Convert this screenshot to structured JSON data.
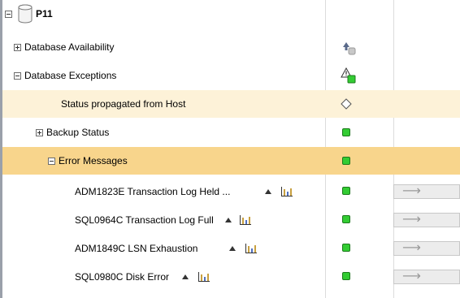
{
  "tree": {
    "root": {
      "label": "P11"
    },
    "rows": [
      {
        "label": "Database Availability",
        "expander": "plus",
        "status_icon": "availability-arrow-icon"
      },
      {
        "label": "Database  Exceptions",
        "expander": "minus",
        "status_icon": "warning-triangle-icon"
      },
      {
        "label": "Status propagated from Host",
        "expander": "none",
        "status_icon": "diamond-icon",
        "highlight": "light"
      },
      {
        "label": "Backup Status",
        "expander": "plus",
        "status_icon": "green-square-icon"
      },
      {
        "label": "Error Messages",
        "expander": "minus",
        "status_icon": "green-square-icon",
        "highlight": "strong"
      },
      {
        "label": "ADM1823E Transaction Log Held ...",
        "expander": "none",
        "status_icon": "green-square-icon",
        "has_action": true
      },
      {
        "label": "SQL0964C Transaction Log Full",
        "expander": "none",
        "status_icon": "green-square-icon",
        "has_action": true
      },
      {
        "label": "ADM1849C LSN Exhaustion",
        "expander": "none",
        "status_icon": "green-square-icon",
        "has_action": true
      },
      {
        "label": "SQL0980C Disk Error",
        "expander": "none",
        "status_icon": "green-square-icon",
        "has_action": true
      }
    ],
    "action_glyph": "⟶"
  },
  "colors": {
    "status_ok": "#33cc33",
    "highlight_light": "#fdf2d8",
    "highlight_strong": "#f8d58c"
  }
}
